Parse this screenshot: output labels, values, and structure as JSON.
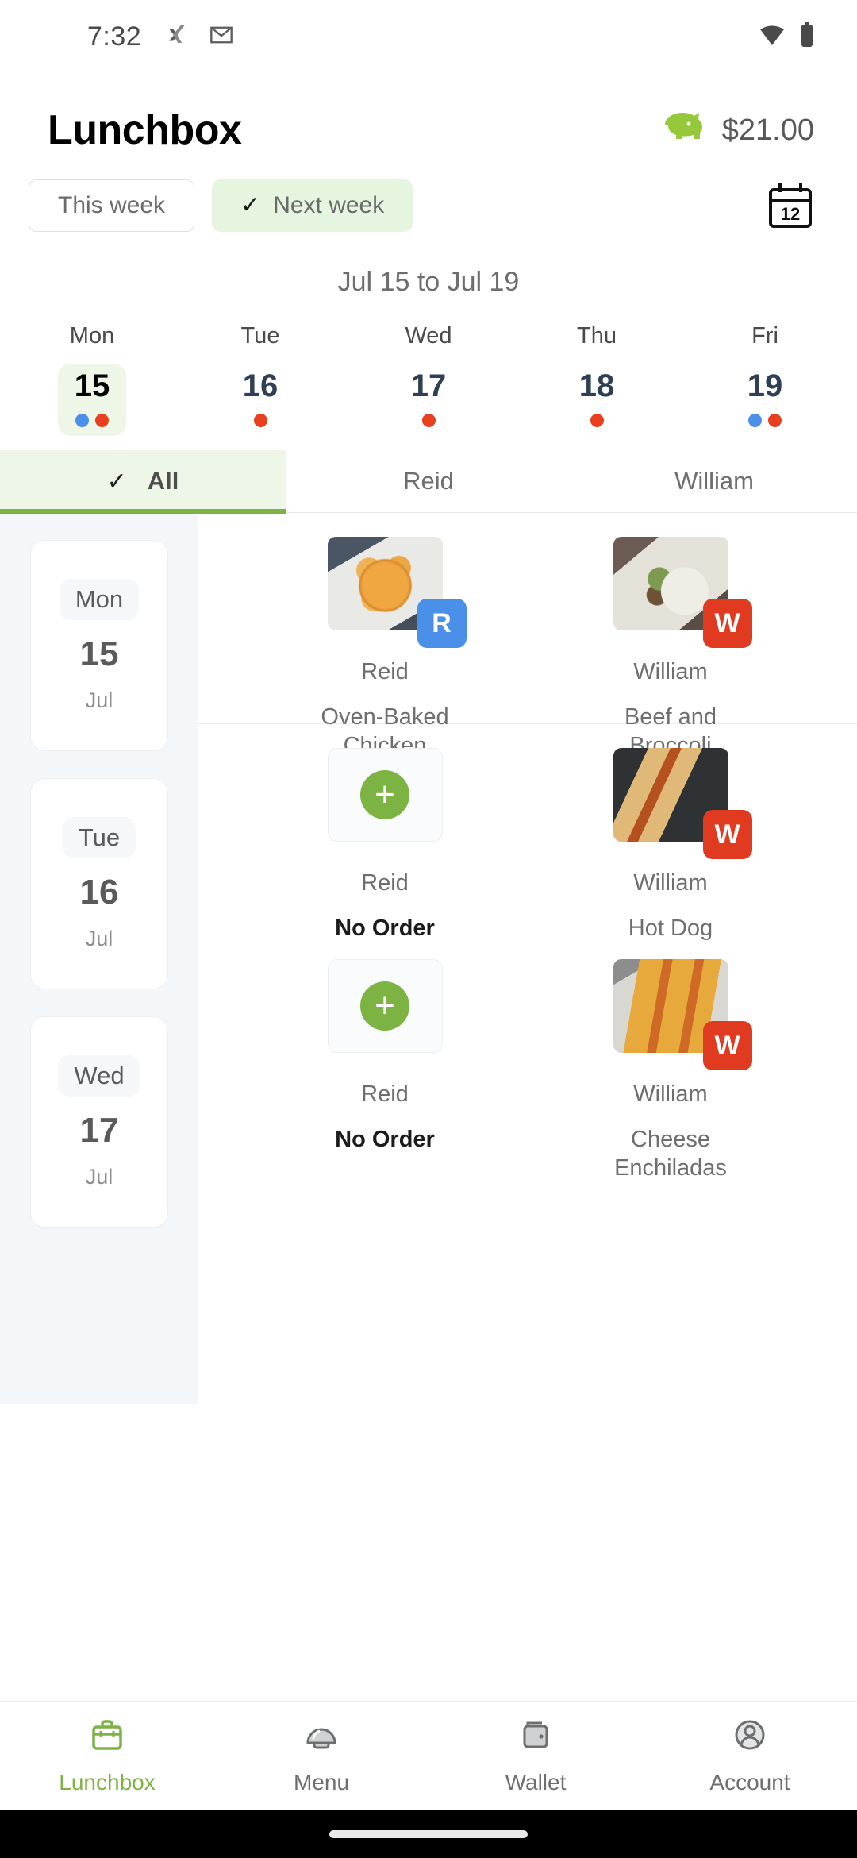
{
  "statusbar": {
    "time": "7:32",
    "icons": [
      "xing-icon",
      "gmail-icon"
    ],
    "right_icons": [
      "wifi-icon",
      "battery-icon"
    ]
  },
  "header": {
    "title": "Lunchbox",
    "balance": "$21.00",
    "piggy_icon": "piggy-bank-icon"
  },
  "week_selector": {
    "this_week_label": "This week",
    "next_week_label": "Next week",
    "selected": "Next week",
    "check_glyph": "✓",
    "calendar_icon_label": "12"
  },
  "date_range": "Jul 15 to Jul 19",
  "day_strip": {
    "days": [
      {
        "name": "Mon",
        "num": "15",
        "selected": true,
        "dots": [
          "#4a90e8",
          "#e8401f"
        ]
      },
      {
        "name": "Tue",
        "num": "16",
        "selected": false,
        "dots": [
          "#e8401f"
        ]
      },
      {
        "name": "Wed",
        "num": "17",
        "selected": false,
        "dots": [
          "#e8401f"
        ]
      },
      {
        "name": "Thu",
        "num": "18",
        "selected": false,
        "dots": [
          "#e8401f"
        ]
      },
      {
        "name": "Fri",
        "num": "19",
        "selected": false,
        "dots": [
          "#4a90e8",
          "#e8401f"
        ]
      }
    ]
  },
  "person_tabs": [
    {
      "label": "All",
      "active": true
    },
    {
      "label": "Reid",
      "active": false
    },
    {
      "label": "William",
      "active": false
    }
  ],
  "rail_days": [
    {
      "dow": "Mon",
      "num": "15",
      "month": "Jul"
    },
    {
      "dow": "Tue",
      "num": "16",
      "month": "Jul"
    },
    {
      "dow": "Wed",
      "num": "17",
      "month": "Jul"
    }
  ],
  "meal_rows": [
    {
      "meals": [
        {
          "person": "Reid",
          "item": "Oven-Baked Chicken Tenders",
          "badge": "R",
          "badge_color": "#4a90e8",
          "has_order": true,
          "image": "img-tenders"
        },
        {
          "person": "William",
          "item": "Beef and Broccoli",
          "badge": "W",
          "badge_color": "#e03a20",
          "has_order": true,
          "image": "img-beef"
        }
      ]
    },
    {
      "meals": [
        {
          "person": "Reid",
          "item": "No Order",
          "badge": "",
          "badge_color": "",
          "has_order": false,
          "image": ""
        },
        {
          "person": "William",
          "item": "Hot Dog",
          "badge": "W",
          "badge_color": "#e03a20",
          "has_order": true,
          "image": "img-hotdog"
        }
      ]
    },
    {
      "meals": [
        {
          "person": "Reid",
          "item": "No Order",
          "badge": "",
          "badge_color": "",
          "has_order": false,
          "image": ""
        },
        {
          "person": "William",
          "item": "Cheese Enchiladas",
          "badge": "W",
          "badge_color": "#e03a20",
          "has_order": true,
          "image": "img-enchilada"
        }
      ]
    }
  ],
  "add_button_glyph": "+",
  "bottom_nav": [
    {
      "label": "Lunchbox",
      "icon": "briefcase-icon",
      "active": true
    },
    {
      "label": "Menu",
      "icon": "food-cloche-icon",
      "active": false
    },
    {
      "label": "Wallet",
      "icon": "wallet-icon",
      "active": false
    },
    {
      "label": "Account",
      "icon": "person-circle-icon",
      "active": false
    }
  ],
  "colors": {
    "accent_green": "#7cb342",
    "chip_green_bg": "#e6f5df",
    "badge_blue": "#4a90e8",
    "badge_red": "#e03a20",
    "dot_red": "#e8401f",
    "rail_bg": "#f3f7fa"
  }
}
